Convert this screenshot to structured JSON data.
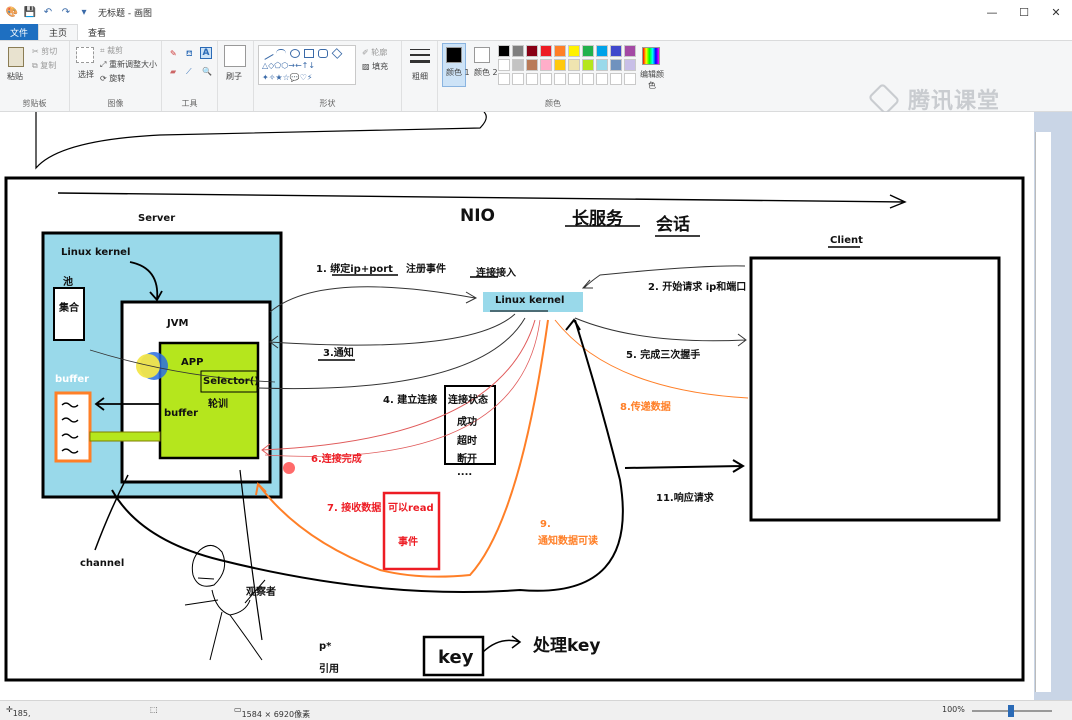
{
  "app": {
    "title": "无标题 - 画图",
    "window_controls": [
      "—",
      "☐",
      "✕"
    ]
  },
  "tabs": {
    "file": "文件",
    "home": "主页",
    "view": "查看"
  },
  "ribbon": {
    "clipboard": {
      "paste": "粘贴",
      "cut": "剪切",
      "copy": "复制",
      "label": "剪贴板"
    },
    "image": {
      "select": "选择",
      "crop": "裁剪",
      "resize": "重新调整大小",
      "rotate": "旋转",
      "label": "图像"
    },
    "tools": {
      "label": "工具"
    },
    "brushes": {
      "label": "刷子"
    },
    "shapes": {
      "outline": "轮廓",
      "fill": "填充",
      "label": "形状"
    },
    "size": {
      "label": "粗细"
    },
    "colors": {
      "color1": "颜色 1",
      "color2": "颜色 2",
      "edit": "编辑颜色",
      "label": "颜色",
      "palette_row1": [
        "#000000",
        "#7f7f7f",
        "#880015",
        "#ed1c24",
        "#ff7f27",
        "#fff200",
        "#22b14c",
        "#00a2e8",
        "#3f48cc",
        "#a349a4"
      ],
      "palette_row2": [
        "#ffffff",
        "#c3c3c3",
        "#b97a57",
        "#ffaec9",
        "#ffc90e",
        "#efe4b0",
        "#b5e61d",
        "#99d9ea",
        "#7092be",
        "#c8bfe7"
      ]
    }
  },
  "watermark": "腾讯课堂",
  "diagram": {
    "server": "Server",
    "linux_kernel_server": "Linux kernel",
    "pool": "池",
    "collection": "集合",
    "jvm": "JVM",
    "app": "APP",
    "selector": "Selector()",
    "polling": "轮训",
    "buffer_inner": "buffer",
    "buffer_outer": "buffer",
    "channel": "channel",
    "observer": "观察者",
    "nio": "NIO",
    "long_service": "长服务",
    "session": "会话",
    "linux_kernel_mid": "Linux kernel",
    "client": "Client",
    "step1": "1.  绑定ip+port",
    "register": "注册事件",
    "conn_accept": "连接接入",
    "step2": "2.  开始请求 ip和端口",
    "step3": "3.通知",
    "step4": "4.  建立连接",
    "conn_state": "连接状态",
    "success": "成功",
    "timeout": "超时",
    "disconnect": "断开",
    "dots": "....",
    "step5": "5.  完成三次握手",
    "step6": "6.连接完成",
    "step7": "7.  接收数据",
    "readable": "可以read",
    "event": "事件",
    "step8": "8.传递数据",
    "step9": "9.",
    "notify_readable": "通知数据可读",
    "step11": "11.响应请求",
    "p_star": "p*",
    "ref": "引用",
    "key": "key",
    "handle_key": "处理key"
  },
  "status": {
    "cursor": "185,",
    "size": "1584 × 6920像素",
    "zoom": "100%"
  }
}
